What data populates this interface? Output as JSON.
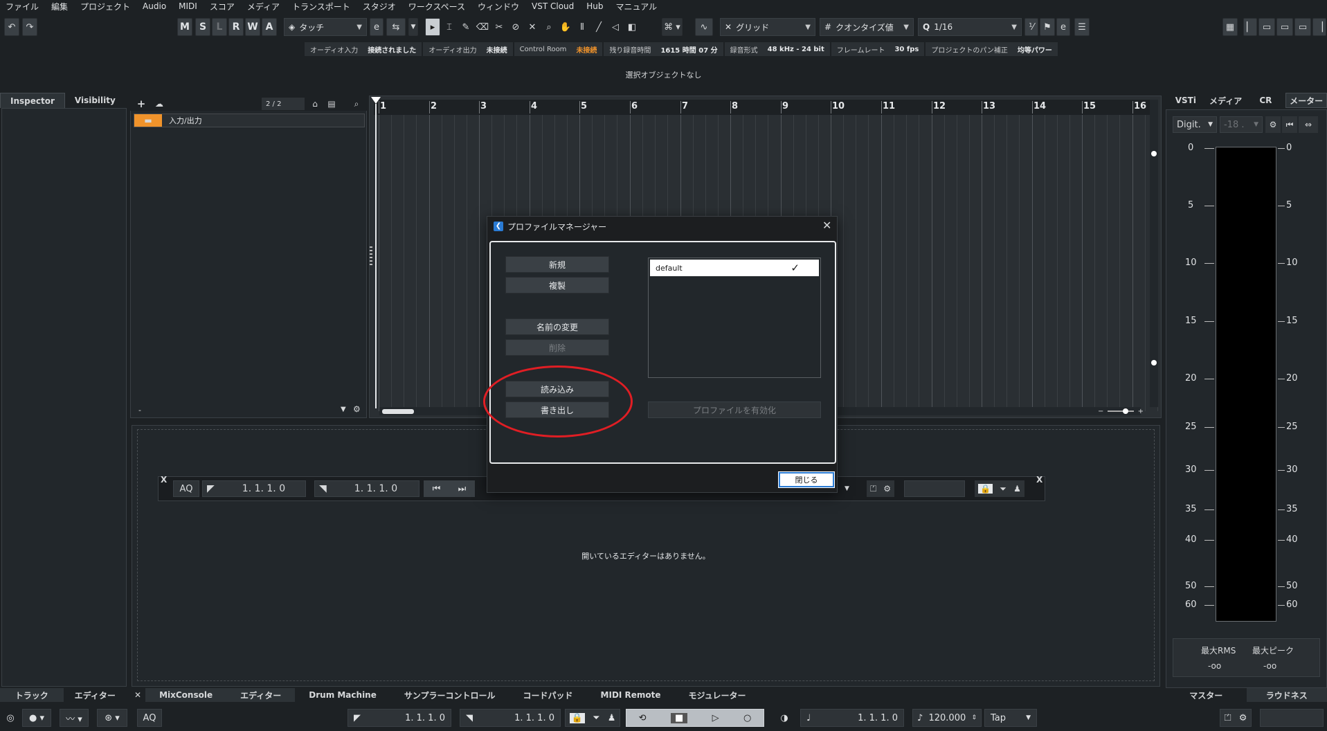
{
  "menubar": [
    "ファイル",
    "編集",
    "プロジェクト",
    "Audio",
    "MIDI",
    "スコア",
    "メディア",
    "トランスポート",
    "スタジオ",
    "ワークスペース",
    "ウィンドウ",
    "VST Cloud",
    "Hub",
    "マニュアル"
  ],
  "toolbar": {
    "automation_buttons": [
      "M",
      "S",
      "L",
      "R",
      "W",
      "A"
    ],
    "automation_mode": "タッチ",
    "snap_type": "グリッド",
    "quantize_type": "クオンタイズ値",
    "quantize_value": "1/16"
  },
  "status": [
    {
      "label": "オーディオ入力",
      "value": "接続されました",
      "orange": false
    },
    {
      "label": "オーディオ出力",
      "value": "未接続",
      "orange": false
    },
    {
      "label": "Control Room",
      "value": "未接続",
      "orange": true
    },
    {
      "label": "残り録音時間",
      "value": "1615 時間 07 分",
      "orange": false
    },
    {
      "label": "録音形式",
      "value": "48 kHz - 24 bit",
      "orange": false
    },
    {
      "label": "フレームレート",
      "value": "30 fps",
      "orange": false
    },
    {
      "label": "プロジェクトのパン補正",
      "value": "均等パワー",
      "orange": false
    }
  ],
  "selection_info": "選択オブジェクトなし",
  "inspector_tabs": [
    "Inspector",
    "Visibility"
  ],
  "tracklist": {
    "counter": "2 / 2",
    "track_name": "入力/出力",
    "footer": "-"
  },
  "ruler_bars": [
    "1",
    "2",
    "3",
    "4",
    "5",
    "6",
    "7",
    "8",
    "9",
    "10",
    "11",
    "12",
    "13",
    "14",
    "15",
    "16"
  ],
  "editor": {
    "no_editor_text": "開いているエディターはありません。",
    "aq_label": "AQ",
    "left_pos": "1. 1. 1.   0",
    "right_pos": "1. 1. 1.   0"
  },
  "dialog": {
    "title": "プロファイルマネージャー",
    "buttons": {
      "new": "新規",
      "duplicate": "複製",
      "rename": "名前の変更",
      "delete": "削除",
      "import": "読み込み",
      "export": "書き出し"
    },
    "profiles": [
      {
        "name": "default",
        "checked": "✓"
      }
    ],
    "activate": "プロファイルを有効化",
    "close": "閉じる"
  },
  "right_tabs": [
    "VSTi",
    "メディア",
    "CR",
    "メーター"
  ],
  "meter": {
    "mode": "Digit.",
    "value": "-18 .",
    "scale": [
      "0",
      "5",
      "10",
      "15",
      "20",
      "25",
      "30",
      "35",
      "40",
      "50",
      "60"
    ],
    "max_rms_label": "最大RMS",
    "max_peak_label": "最大ピーク",
    "max_rms_value": "-oo",
    "max_peak_value": "-oo"
  },
  "left_bottom_tabs": [
    "トラック",
    "エディター"
  ],
  "lower_tabs": [
    "MixConsole",
    "エディター",
    "Drum Machine",
    "サンプラーコントロール",
    "コードパッド",
    "MIDI Remote",
    "モジュレーター"
  ],
  "right_bottom_tabs": [
    "マスター",
    "ラウドネス"
  ],
  "transport": {
    "aq": "AQ",
    "left_locator": "1. 1. 1.   0",
    "right_locator": "1. 1. 1.   0",
    "position": "1. 1. 1.   0",
    "tempo": "120.000",
    "tap": "Tap"
  }
}
